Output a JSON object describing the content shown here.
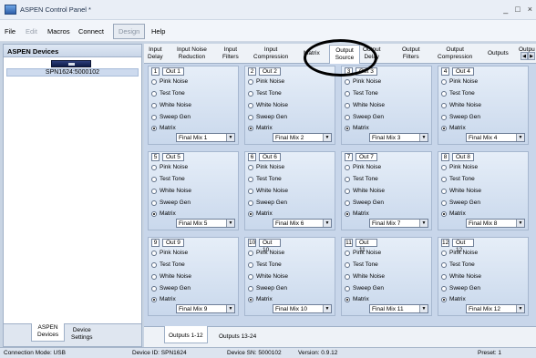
{
  "window": {
    "title": "ASPEN Control Panel *",
    "controls": [
      "_",
      "□",
      "×"
    ]
  },
  "menubar": {
    "items": [
      "File",
      "Edit",
      "Macros",
      "Connect",
      "Design",
      "Help"
    ]
  },
  "sidebar": {
    "title": "ASPEN Devices",
    "device": "SPN1624:5000102",
    "tabs": [
      {
        "l1": "ASPEN",
        "l2": "Devices"
      },
      {
        "l1": "Device",
        "l2": "Settings"
      }
    ]
  },
  "tabs": [
    {
      "l1": "Input",
      "l2": "Delay"
    },
    {
      "l1": "Input Noise",
      "l2": "Reduction"
    },
    {
      "l1": "Input",
      "l2": "Filters"
    },
    {
      "l1": "Input",
      "l2": "Compression"
    },
    {
      "l1": "Matrix",
      "l2": ""
    },
    {
      "l1": "Output",
      "l2": "Source"
    },
    {
      "l1": "Output",
      "l2": "Delay"
    },
    {
      "l1": "Output",
      "l2": "Filters"
    },
    {
      "l1": "Output",
      "l2": "Compression"
    },
    {
      "l1": "Outputs",
      "l2": ""
    },
    {
      "l1": "Outpu",
      "l2": ""
    }
  ],
  "radio_options": [
    "Pink Noise",
    "Test Tone",
    "White Noise",
    "Sweep Gen",
    "Matrix"
  ],
  "outputs": [
    {
      "num": "1",
      "name": "Out 1",
      "source": "Final Mix 1"
    },
    {
      "num": "2",
      "name": "Out 2",
      "source": "Final Mix 2"
    },
    {
      "num": "3",
      "name": "Out 3",
      "source": "Final Mix 3"
    },
    {
      "num": "4",
      "name": "Out 4",
      "source": "Final Mix 4"
    },
    {
      "num": "5",
      "name": "Out 5",
      "source": "Final Mix 5"
    },
    {
      "num": "6",
      "name": "Out 6",
      "source": "Final Mix 6"
    },
    {
      "num": "7",
      "name": "Out 7",
      "source": "Final Mix 7"
    },
    {
      "num": "8",
      "name": "Out 8",
      "source": "Final Mix 8"
    },
    {
      "num": "9",
      "name": "Out 9",
      "source": "Final Mix 9"
    },
    {
      "num": "10",
      "name": "Out 10",
      "source": "Final Mix 10"
    },
    {
      "num": "11",
      "name": "Out 11",
      "source": "Final Mix 11"
    },
    {
      "num": "12",
      "name": "Out 12",
      "source": "Final Mix 12"
    }
  ],
  "bottom_tabs": [
    "Outputs 1-12",
    "Outputs 13-24"
  ],
  "status": {
    "connection": "Connection Mode: USB",
    "device_id": "Device ID: SPN1624",
    "device_sn": "Device SN: 5000102",
    "version": "Version: 0.9.12",
    "preset": "Preset: 1"
  }
}
